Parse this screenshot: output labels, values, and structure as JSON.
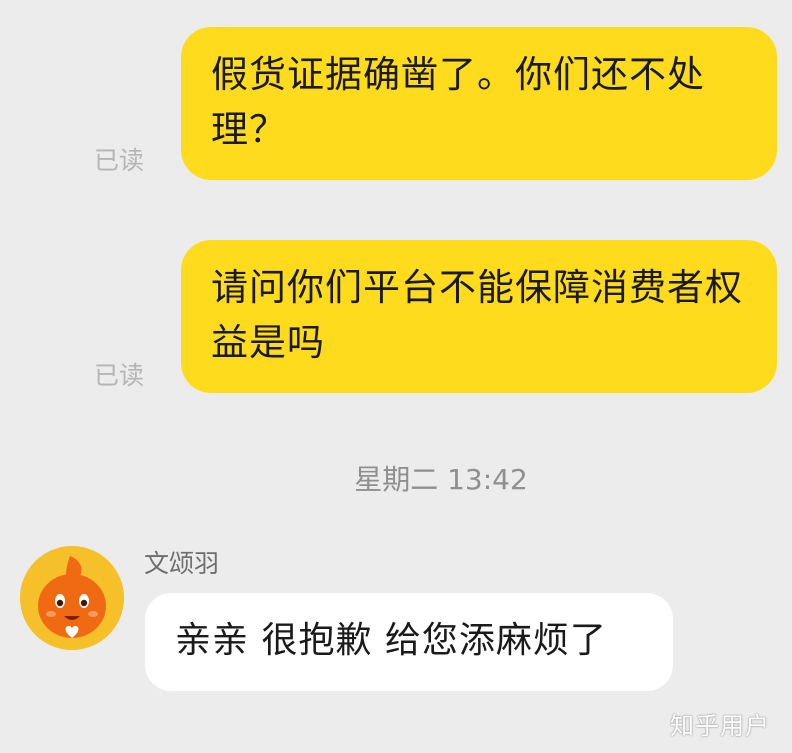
{
  "messages": [
    {
      "direction": "outgoing",
      "text": "假货证据确凿了。你们还不处理？",
      "status": "已读"
    },
    {
      "direction": "outgoing",
      "text": "请问你们平台不能保障消费者权益是吗",
      "status": "已读"
    }
  ],
  "timestamp": "星期二 13:42",
  "reply": {
    "sender": "文颂羽",
    "text": "亲亲 很抱歉 给您添麻烦了",
    "avatar_icon": "orange-mascot-avatar"
  },
  "watermark": "知乎用户",
  "colors": {
    "background": "#ececec",
    "outgoing_bubble": "#ffdb1e",
    "incoming_bubble": "#ffffff",
    "avatar_bg": "#f6c02a",
    "mascot": "#ef6a12"
  }
}
